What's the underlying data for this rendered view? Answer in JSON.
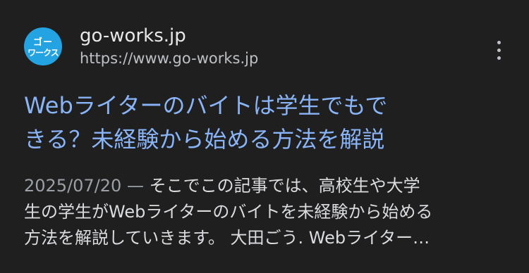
{
  "result": {
    "site_name": "go-works.jp",
    "site_url": "https://www.go-works.jp",
    "favicon": {
      "line1": "ゴー",
      "line2": "ワークス",
      "color": "#24a3e3"
    },
    "title_lines": [
      "Webライターのバイトは学生でもで",
      "きる？未経験から始める方法を解説"
    ],
    "date": "2025/07/20",
    "date_separator": " — ",
    "snippet_lines": [
      "そこでこの記事では、高校生や大学",
      "生の学生がWebライターのバイトを未経験から始める",
      "方法を解説していきます。 大田ごう. Webライター…"
    ],
    "more_icon": "more-vertical-icon"
  },
  "colors": {
    "background": "#1f1f1f",
    "title": "#8ab4f8",
    "text": "#dadce0",
    "muted": "#9aa0a6"
  }
}
